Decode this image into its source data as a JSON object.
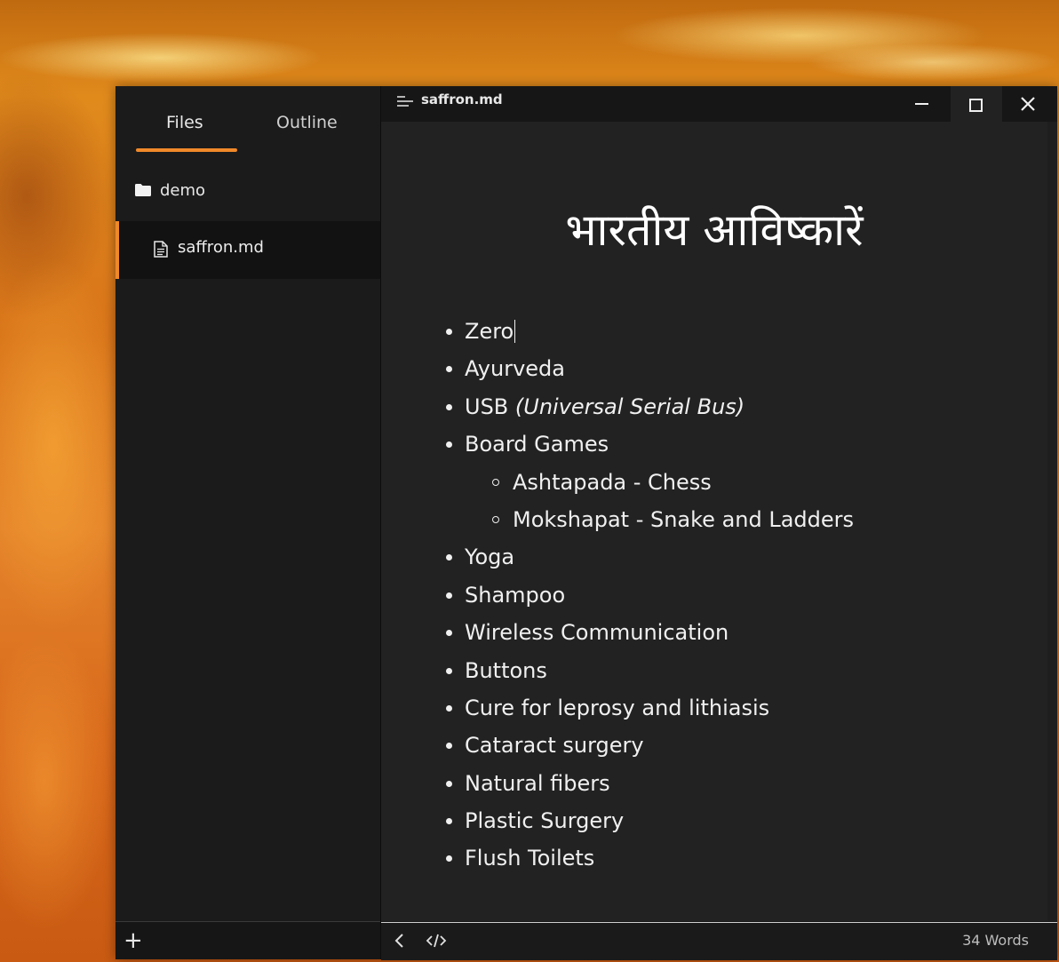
{
  "sidebar": {
    "tabs": [
      {
        "label": "Files",
        "active": true
      },
      {
        "label": "Outline",
        "active": false
      }
    ],
    "folder": {
      "name": "demo",
      "icon": "folder-icon"
    },
    "files": [
      {
        "name": "saffron.md",
        "icon": "file-icon",
        "active": true
      }
    ],
    "add_button": "+"
  },
  "titlebar": {
    "filename": "saffron.md",
    "icon": "menu-icon"
  },
  "document": {
    "heading": "भारतीय आविष्कारें",
    "items": [
      {
        "text": "Zero",
        "level": 1
      },
      {
        "text": "Ayurveda",
        "level": 1
      },
      {
        "text": "USB ",
        "italic": "(Universal Serial Bus)",
        "level": 1
      },
      {
        "text": "Board Games",
        "level": 1
      },
      {
        "text": "Ashtapada - Chess",
        "level": 2
      },
      {
        "text": "Mokshapat - Snake and Ladders",
        "level": 2
      },
      {
        "text": "Yoga",
        "level": 1
      },
      {
        "text": "Shampoo",
        "level": 1
      },
      {
        "text": "Wireless Communication",
        "level": 1
      },
      {
        "text": "Buttons",
        "level": 1
      },
      {
        "text": "Cure for leprosy and lithiasis",
        "level": 1
      },
      {
        "text": "Cataract surgery",
        "level": 1
      },
      {
        "text": "Natural fibers",
        "level": 1
      },
      {
        "text": "Plastic Surgery",
        "level": 1
      },
      {
        "text": "Flush Toilets",
        "level": 1
      }
    ]
  },
  "statusbar": {
    "word_count": "34 Words"
  },
  "colors": {
    "accent": "#f0892a",
    "background": "#222222",
    "sidebar": "#1b1b1b"
  }
}
